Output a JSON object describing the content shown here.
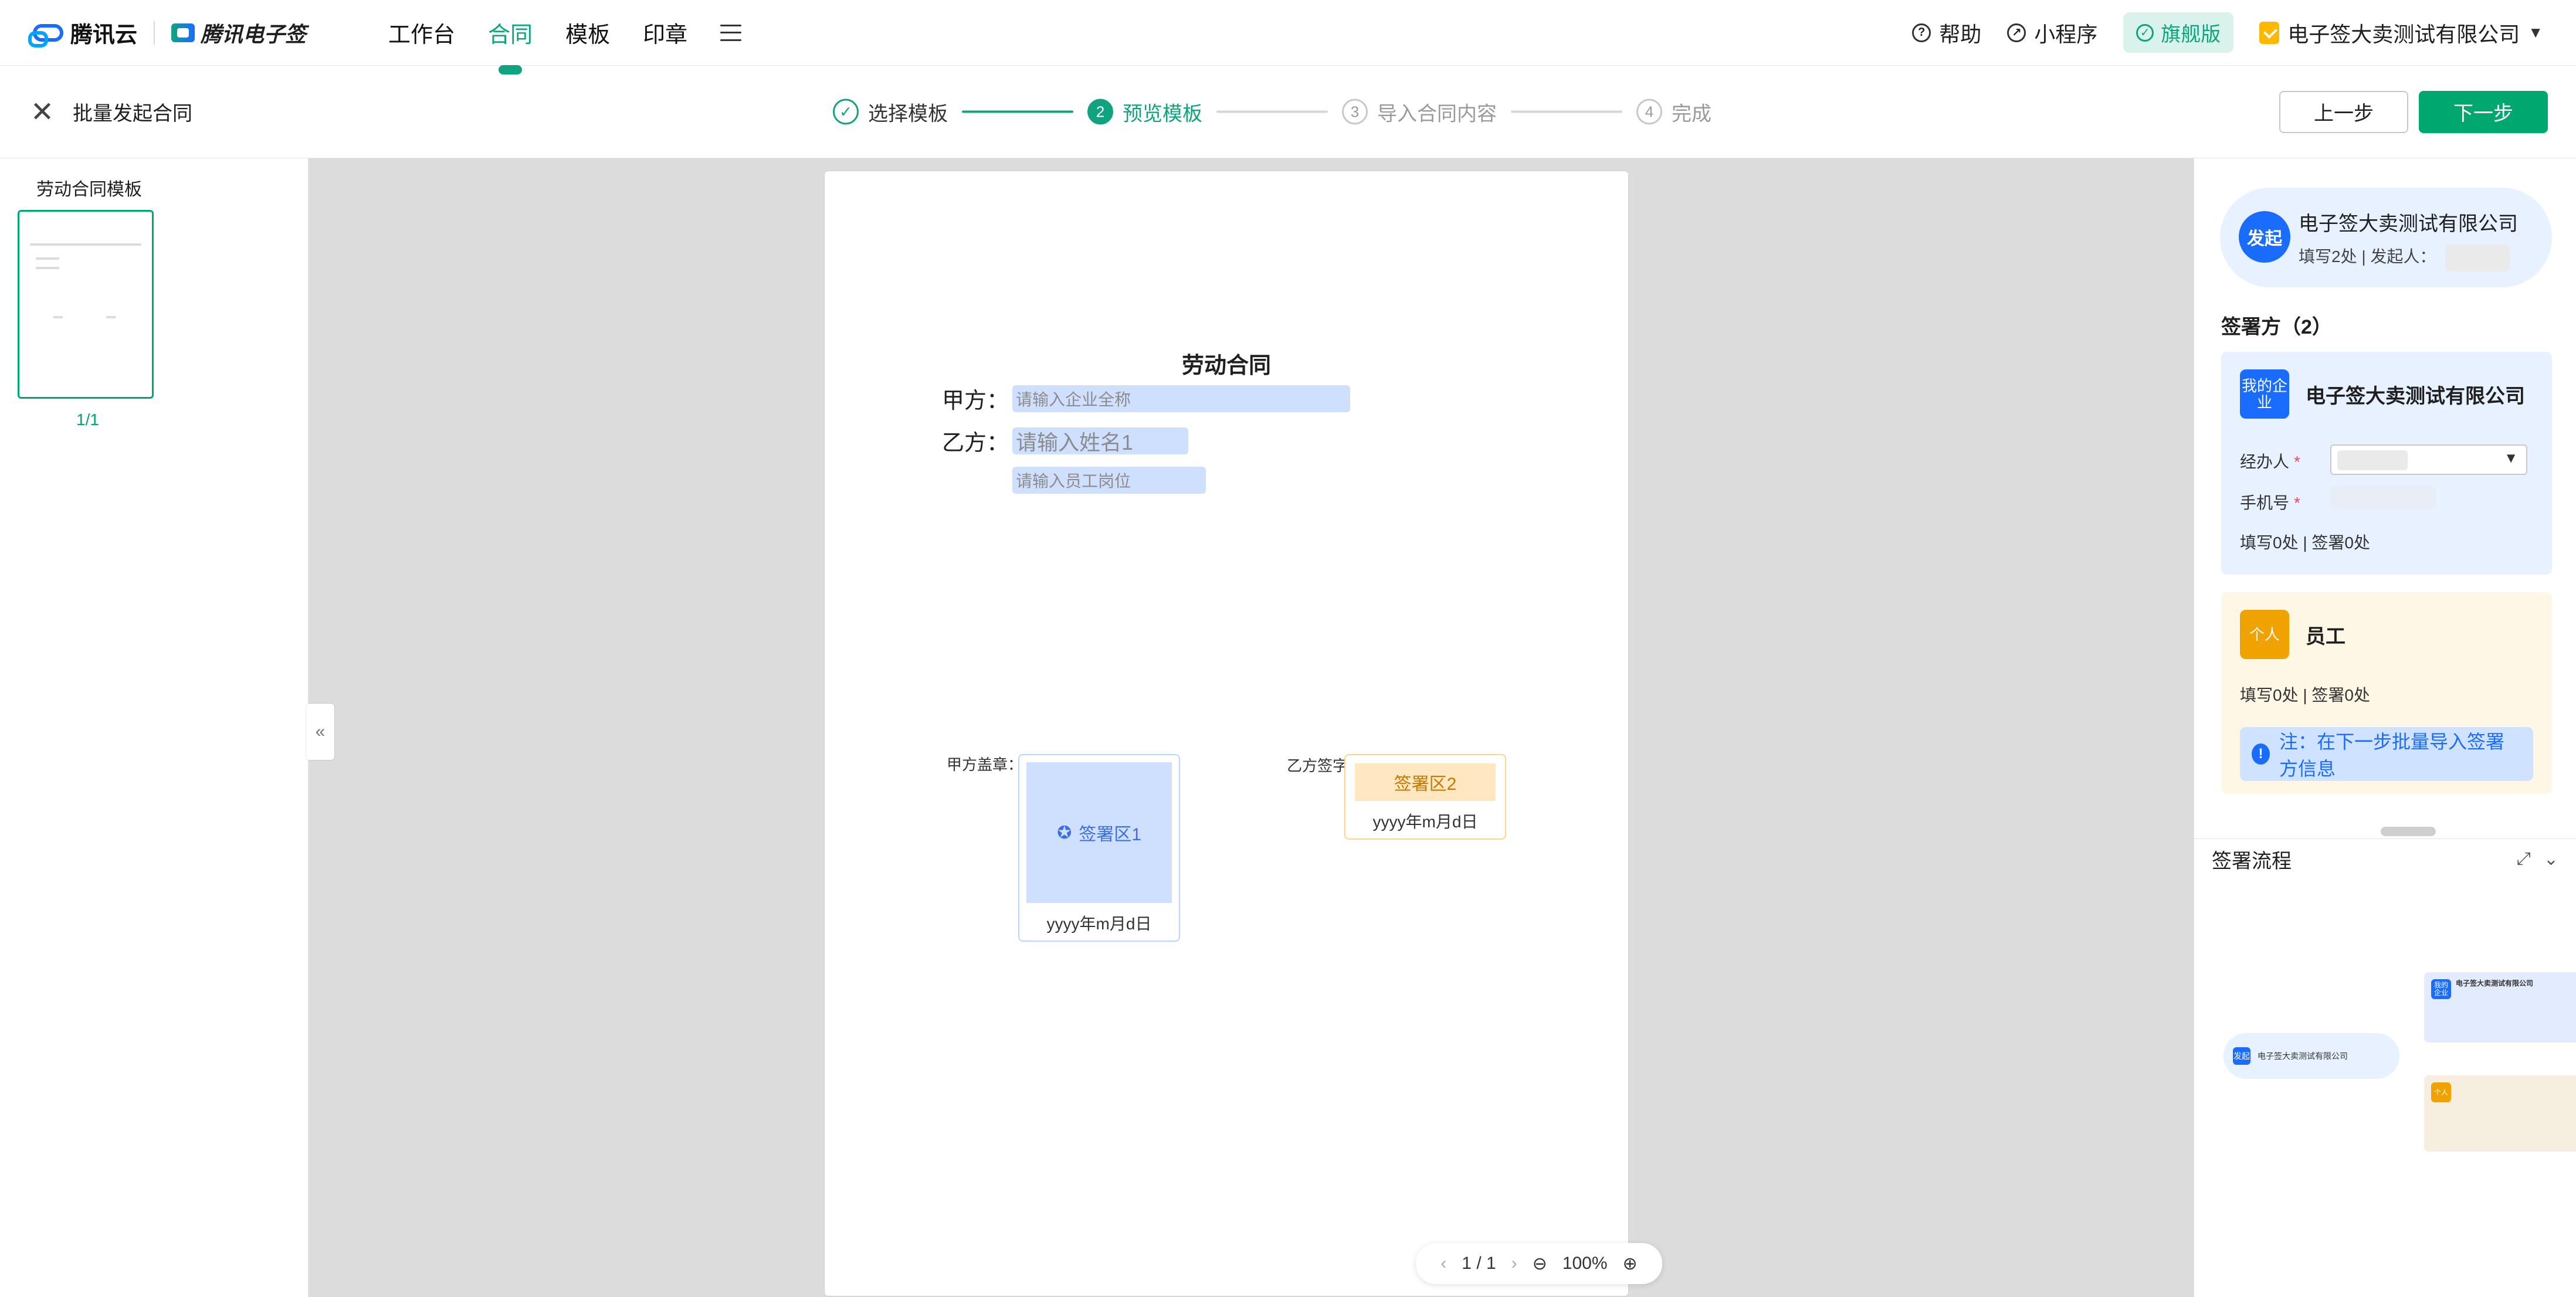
{
  "topbar": {
    "brand_left": "腾讯云",
    "brand_right": "腾讯电子签",
    "nav": [
      {
        "label": "工作台"
      },
      {
        "label": "合同"
      },
      {
        "label": "模板"
      },
      {
        "label": "印章"
      }
    ],
    "right": {
      "help": "帮助",
      "mini_program": "小程序",
      "edition": "旗舰版",
      "company": "电子签大卖测试有限公司"
    }
  },
  "stepbar": {
    "title": "批量发起合同",
    "steps": [
      {
        "label": "选择模板",
        "num": "✓"
      },
      {
        "label": "预览模板",
        "num": "2"
      },
      {
        "label": "导入合同内容",
        "num": "3"
      },
      {
        "label": "完成",
        "num": "4"
      }
    ],
    "actions": {
      "prev": "上一步",
      "next": "下一步"
    }
  },
  "left": {
    "template_name": "劳动合同模板",
    "page_indicator": "1/1"
  },
  "doc": {
    "title": "劳动合同",
    "party_a_label": "甲方：",
    "party_a_placeholder": "请输入企业全称",
    "party_b_label": "乙方：",
    "party_b_name_placeholder": "请输入姓名1",
    "party_b_position_placeholder": "请输入员工岗位",
    "seal_a_label": "甲方盖章：",
    "seal_a_area": "签署区1",
    "seal_a_date": "yyyy年m月d日",
    "seal_b_label": "乙方签字",
    "seal_b_area": "签署区2",
    "seal_b_date": "yyyy年m月d日"
  },
  "zoom": {
    "page": "1 / 1",
    "percent": "100%"
  },
  "right": {
    "initiator": {
      "badge": "发起",
      "company": "电子签大卖测试有限公司",
      "sub": "填写2处 | 发起人："
    },
    "signers_title": "签署方（2）",
    "signer_company": {
      "tag": "我的企业",
      "name": "电子签大卖测试有限公司",
      "handler_label": "经办人",
      "phone_label": "手机号",
      "counts": "填写0处 | 签署0处"
    },
    "signer_person": {
      "tag": "个人",
      "name": "员工",
      "counts": "填写0处 | 签署0处",
      "notice": "注：在下一步批量导入签署方信息"
    },
    "flow": {
      "title": "签署流程"
    }
  }
}
